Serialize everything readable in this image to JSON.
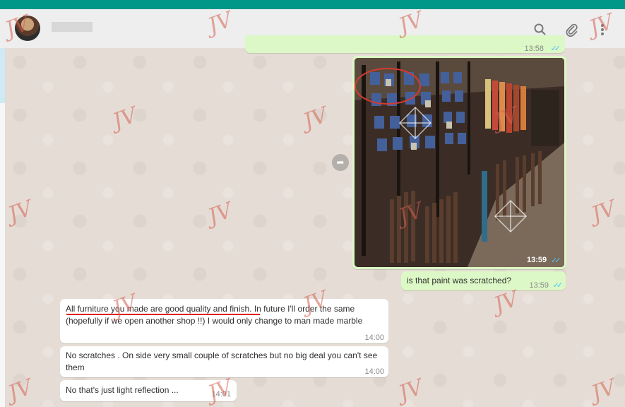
{
  "window": {
    "accent_color": "#009688"
  },
  "header": {
    "contact_name": "",
    "icons": [
      "search-icon",
      "paperclip-icon",
      "menu-icon"
    ]
  },
  "watermark": {
    "text": "JV"
  },
  "messages": [
    {
      "direction": "out",
      "text": "",
      "time": "13:58",
      "status": "read",
      "partial": true
    },
    {
      "direction": "out",
      "type": "image",
      "time": "13:59",
      "status": "read"
    },
    {
      "direction": "out",
      "text": "is that paint was scratched?",
      "time": "13:59",
      "status": "read"
    },
    {
      "direction": "in",
      "text": "All furniture you made are good quality and finish. In future I'll order the same (hopefully if we open another shop !!) I would only change to man made marble",
      "time": "14:00"
    },
    {
      "direction": "in",
      "text": "No scratches . On side very small couple of scratches but no big deal you can't see them",
      "time": "14:00"
    },
    {
      "direction": "in",
      "text": "No that's just light reflection ...",
      "time": "14:01"
    }
  ],
  "colors": {
    "outgoing_bubble": "#dcf8c6",
    "incoming_bubble": "#ffffff",
    "read_ticks": "#4fc3f7",
    "annotation": "#e02020",
    "chat_bg": "#e5ddd5"
  }
}
